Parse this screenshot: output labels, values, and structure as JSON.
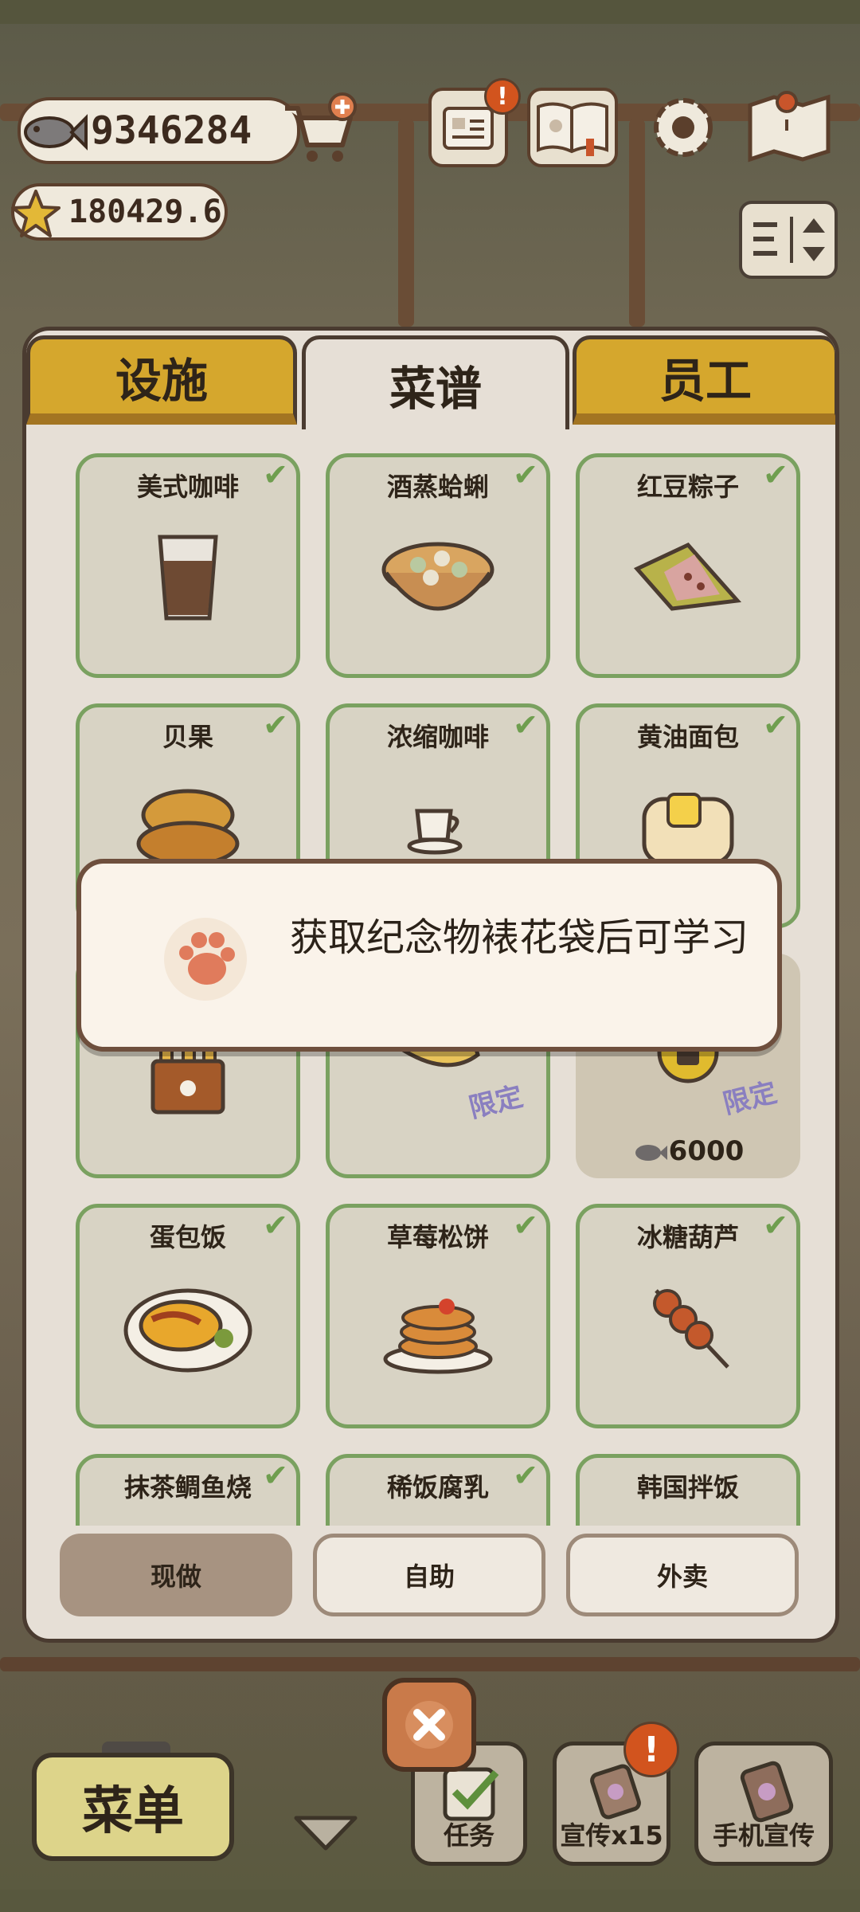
{
  "hud": {
    "fish_count": "9346284",
    "star_count": "180429.6"
  },
  "tabs": [
    "设施",
    "菜谱",
    "员工"
  ],
  "recipes": [
    {
      "name": "美式咖啡",
      "learned": true,
      "icon": "coffee-glass-icon"
    },
    {
      "name": "酒蒸蛤蜊",
      "learned": true,
      "icon": "clams-bowl-icon"
    },
    {
      "name": "红豆粽子",
      "learned": true,
      "icon": "zongzi-icon"
    },
    {
      "name": "贝果",
      "learned": true,
      "icon": "bagel-icon"
    },
    {
      "name": "浓缩咖啡",
      "learned": true,
      "icon": "espresso-cup-icon"
    },
    {
      "name": "黄油面包",
      "learned": true,
      "icon": "butter-bread-icon"
    },
    {
      "name": "",
      "learned": false,
      "icon": "fries-bag-icon"
    },
    {
      "name": "",
      "learned": false,
      "icon": "fortune-cookie-icon",
      "tag": "限定"
    },
    {
      "name": "",
      "learned": false,
      "icon": "lock-icon",
      "tag": "限定",
      "price": "6000",
      "locked": true
    },
    {
      "name": "蛋包饭",
      "learned": true,
      "icon": "omurice-icon"
    },
    {
      "name": "草莓松饼",
      "learned": true,
      "icon": "pancake-icon"
    },
    {
      "name": "冰糖葫芦",
      "learned": true,
      "icon": "tanghulu-icon"
    },
    {
      "name": "抹茶鲷鱼烧",
      "learned": true,
      "icon": "taiyaki-icon"
    },
    {
      "name": "稀饭腐乳",
      "learned": true,
      "icon": "congee-icon"
    },
    {
      "name": "韩国拌饭",
      "learned": false,
      "icon": "bibimbap-icon"
    }
  ],
  "bottom_tabs": [
    "现做",
    "自助",
    "外卖"
  ],
  "toast": {
    "message": "获取纪念物裱花袋后可学习"
  },
  "bottom_bar": {
    "menu_label": "菜单",
    "task_label": "任务",
    "promo_label": "宣传x15",
    "phone_promo_label": "手机宣传",
    "badge": "!"
  },
  "colors": {
    "panel_bg": "#e6dfd6",
    "tab_gold": "#d5a72d",
    "card_border_green": "#7aa160",
    "tag_purple": "#8a7fc0",
    "toast_border": "#6e4f3d"
  }
}
